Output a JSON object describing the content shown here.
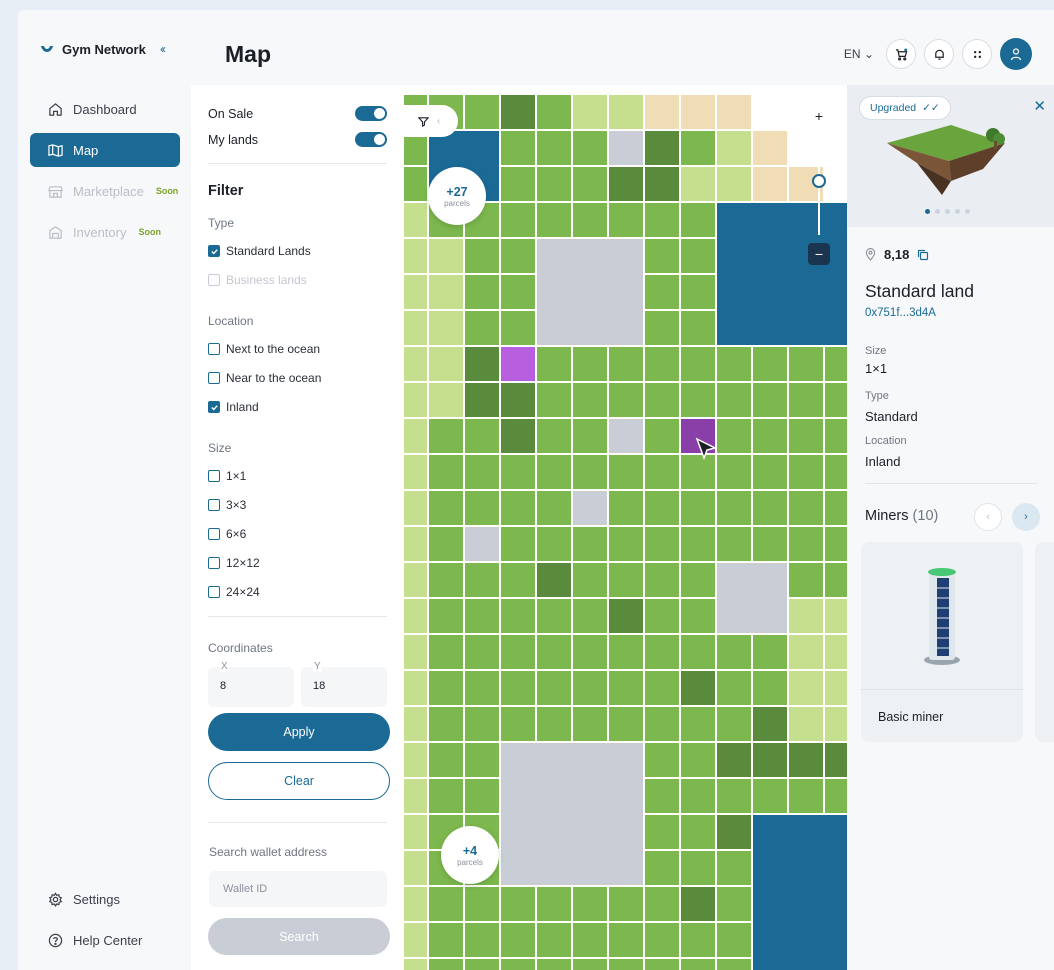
{
  "brand": {
    "name": "Gym Network",
    "collapse": "‹‹"
  },
  "sidebar": {
    "items": [
      {
        "label": "Dashboard",
        "icon": "home-icon"
      },
      {
        "label": "Map",
        "icon": "map-icon"
      },
      {
        "label": "Marketplace",
        "icon": "store-icon",
        "badge": "Soon"
      },
      {
        "label": "Inventory",
        "icon": "inventory-icon",
        "badge": "Soon"
      }
    ],
    "bottom": [
      {
        "label": "Settings",
        "icon": "gear-icon"
      },
      {
        "label": "Help Center",
        "icon": "help-icon"
      }
    ]
  },
  "header": {
    "title": "Map",
    "language": "EN"
  },
  "filters": {
    "on_sale": "On Sale",
    "my_lands": "My lands",
    "title": "Filter",
    "type_label": "Type",
    "type_options": [
      "Standard Lands",
      "Business lands"
    ],
    "location_label": "Location",
    "location_options": [
      "Next to the ocean",
      "Near to the ocean",
      "Inland"
    ],
    "size_label": "Size",
    "size_options": [
      "1×1",
      "3×3",
      "6×6",
      "12×12",
      "24×24"
    ],
    "coordinates_label": "Coordinates",
    "x_label": "X",
    "x_value": "8",
    "y_label": "Y",
    "y_value": "18",
    "apply": "Apply",
    "clear": "Clear",
    "search_label": "Search wallet address",
    "wallet_placeholder": "Wallet ID",
    "search": "Search"
  },
  "map": {
    "clusters": [
      {
        "count": "+27",
        "label": "parcels"
      },
      {
        "count": "+4",
        "label": "parcels"
      }
    ],
    "zoom_in": "+",
    "zoom_out": "−"
  },
  "detail": {
    "badge": "Upgraded",
    "coords": "8,18",
    "land_type": "Standard land",
    "address": "0x751f...3d4A",
    "size_label": "Size",
    "size_value": "1×1",
    "type_label": "Type",
    "type_value": "Standard",
    "location_label": "Location",
    "location_value": "Inland",
    "miners_label": "Miners",
    "miners_count": "(10)",
    "miner_name": "Basic miner"
  },
  "colors": {
    "accent": "#1b6a96",
    "land": "#7cb84d",
    "land_dark": "#5a8a3c",
    "land_light": "#c5df8f",
    "sand": "#f0ddb6",
    "ocean": "#1b6a96",
    "plot_gray": "#c9ced6",
    "selected": "#8a3ea8",
    "highlight": "#b85fe0"
  }
}
